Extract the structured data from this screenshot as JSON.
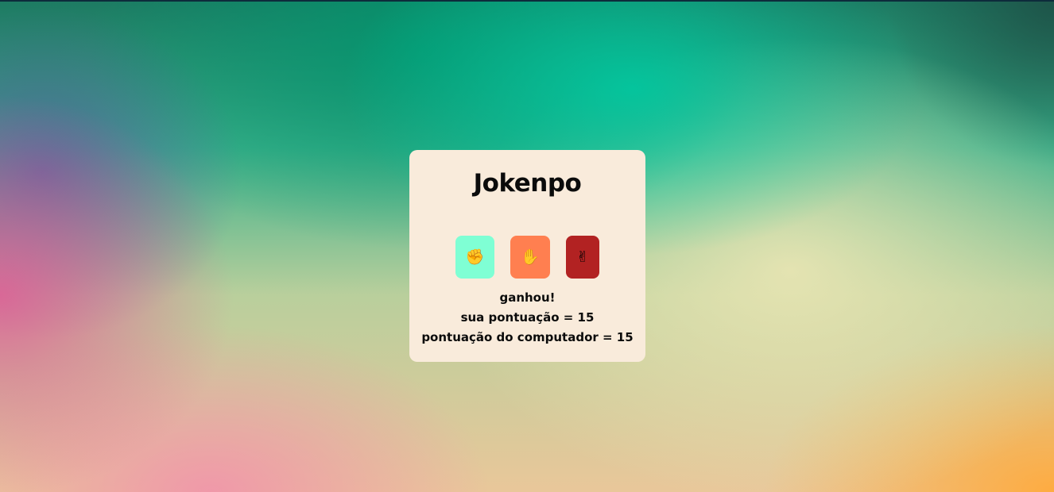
{
  "game": {
    "title": "Jokenpo",
    "choices": [
      {
        "id": "rock",
        "icon": "fist-icon",
        "glyph": "✊",
        "color": "#7fffd4"
      },
      {
        "id": "paper",
        "icon": "raised-hand-icon",
        "glyph": "✋",
        "color": "#ff7f50"
      },
      {
        "id": "scissors",
        "icon": "victory-hand-icon",
        "glyph": "✌",
        "color": "#b22222"
      }
    ],
    "result": {
      "outcome": "ganhou!",
      "player_score_text": "sua pontuação = 15",
      "computer_score_text": "pontuação do computador = 15"
    }
  }
}
